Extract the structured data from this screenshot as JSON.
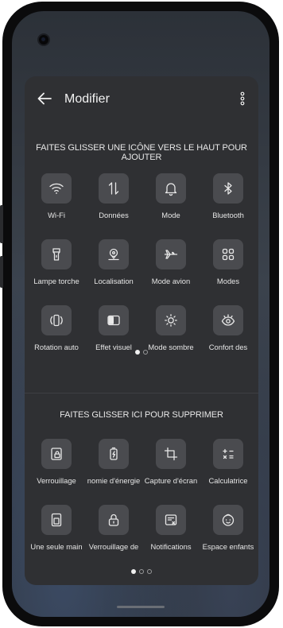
{
  "header": {
    "title": "Modifier"
  },
  "add_hint": "FAITES GLISSER UNE ICÔNE VERS LE HAUT POUR AJOUTER",
  "remove_hint": "FAITES GLISSER ICI POUR SUPPRIMER",
  "active_tiles": [
    {
      "label": "Wi-Fi",
      "icon": "wifi-icon"
    },
    {
      "label": "Données",
      "icon": "data-icon"
    },
    {
      "label": "Mode",
      "icon": "bell-icon"
    },
    {
      "label": "Bluetooth",
      "icon": "bluetooth-icon"
    },
    {
      "label": "Lampe torche",
      "icon": "flashlight-icon"
    },
    {
      "label": "Localisation",
      "icon": "location-icon"
    },
    {
      "label": "Mode avion",
      "icon": "airplane-icon"
    },
    {
      "label": "Modes",
      "icon": "grid-icon"
    },
    {
      "label": "Rotation auto",
      "icon": "rotation-icon"
    },
    {
      "label": "Effet visuel",
      "icon": "visual-effect-icon"
    },
    {
      "label": "Mode sombre",
      "icon": "dark-mode-icon"
    },
    {
      "label": "Confort des",
      "icon": "eye-comfort-icon"
    }
  ],
  "available_tiles": [
    {
      "label": "Verrouillage",
      "icon": "lock-screen-icon"
    },
    {
      "label": "nomie d'énergie",
      "icon": "battery-saver-icon"
    },
    {
      "label": "Capture d'écran",
      "icon": "screenshot-icon"
    },
    {
      "label": "Calculatrice",
      "icon": "calculator-icon"
    },
    {
      "label": "Une seule main",
      "icon": "one-hand-icon"
    },
    {
      "label": "Verrouillage de",
      "icon": "lock-icon"
    },
    {
      "label": "Notifications",
      "icon": "notifications-icon"
    },
    {
      "label": "Espace enfants",
      "icon": "kids-space-icon"
    }
  ],
  "pages_top": {
    "current": 1,
    "total": 2
  },
  "pages_bottom": {
    "current": 1,
    "total": 3
  },
  "colors": {
    "panel": "#2f3033",
    "tile": "#4a4b4f",
    "text": "#e6e6e6"
  }
}
